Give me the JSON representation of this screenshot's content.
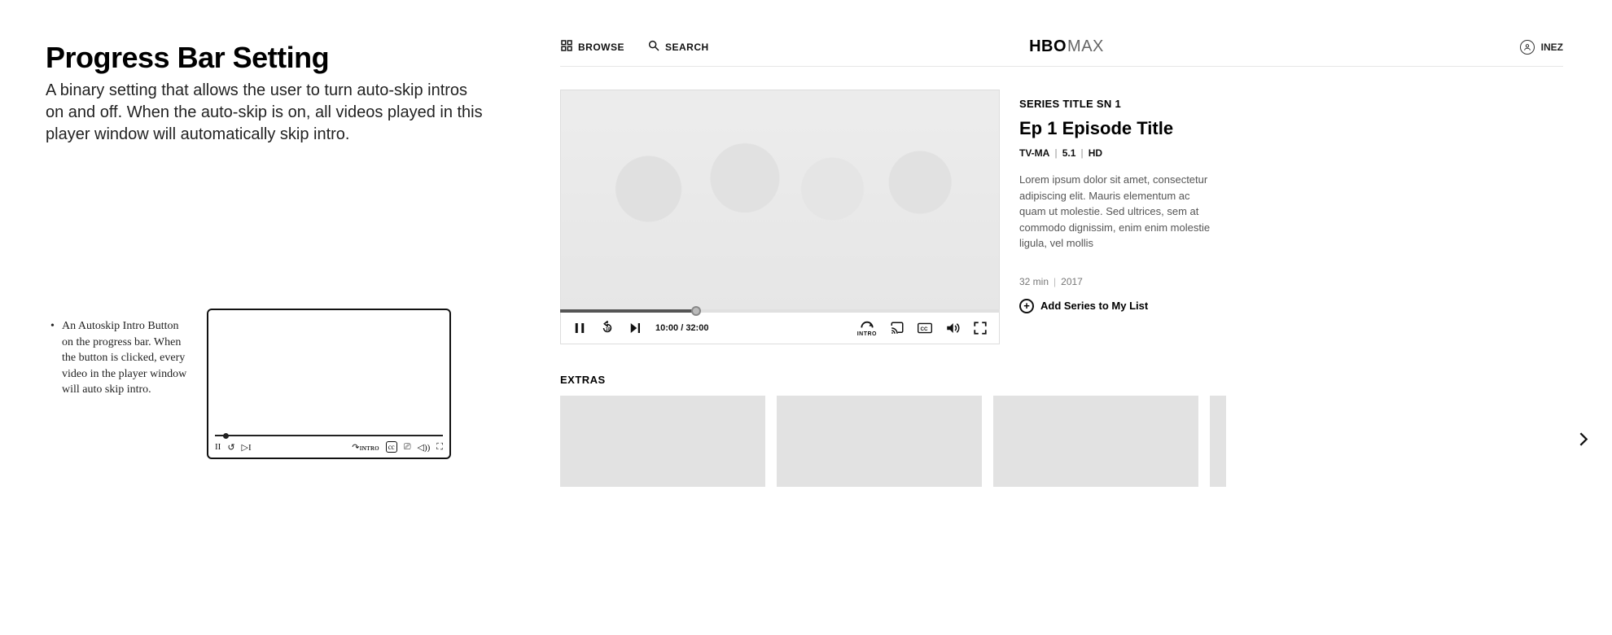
{
  "spec": {
    "heading": "Progress Bar Setting",
    "description": "A binary setting that allows the user to turn auto-skip intros on and off. When the auto-skip is on, all videos played in this player window will automatically skip intro.",
    "sketch_note": "An Autoskip Intro Button on the progress bar. When the button is clicked, every video in the player window will auto skip intro."
  },
  "nav": {
    "browse": "BROWSE",
    "search": "SEARCH",
    "logo_bold": "HBO",
    "logo_light": "MAX",
    "profile_name": "INEZ"
  },
  "player": {
    "time_current": "10:00",
    "time_total": "32:00",
    "intro_label": "INTRO",
    "cc_label": "CC"
  },
  "meta": {
    "series_line": "SERIES TITLE SN 1",
    "episode_title": "Ep 1 Episode Title",
    "rating": "TV-MA",
    "audio": "5.1",
    "quality": "HD",
    "synopsis": "Lorem ipsum dolor sit amet, consectetur adipiscing elit. Mauris elementum ac quam ut molestie. Sed ultrices, sem at commodo dignissim, enim enim molestie ligula, vel mollis",
    "duration": "32 min",
    "year": "2017",
    "add_label": "Add Series to My List"
  },
  "extras": {
    "heading": "EXTRAS"
  }
}
